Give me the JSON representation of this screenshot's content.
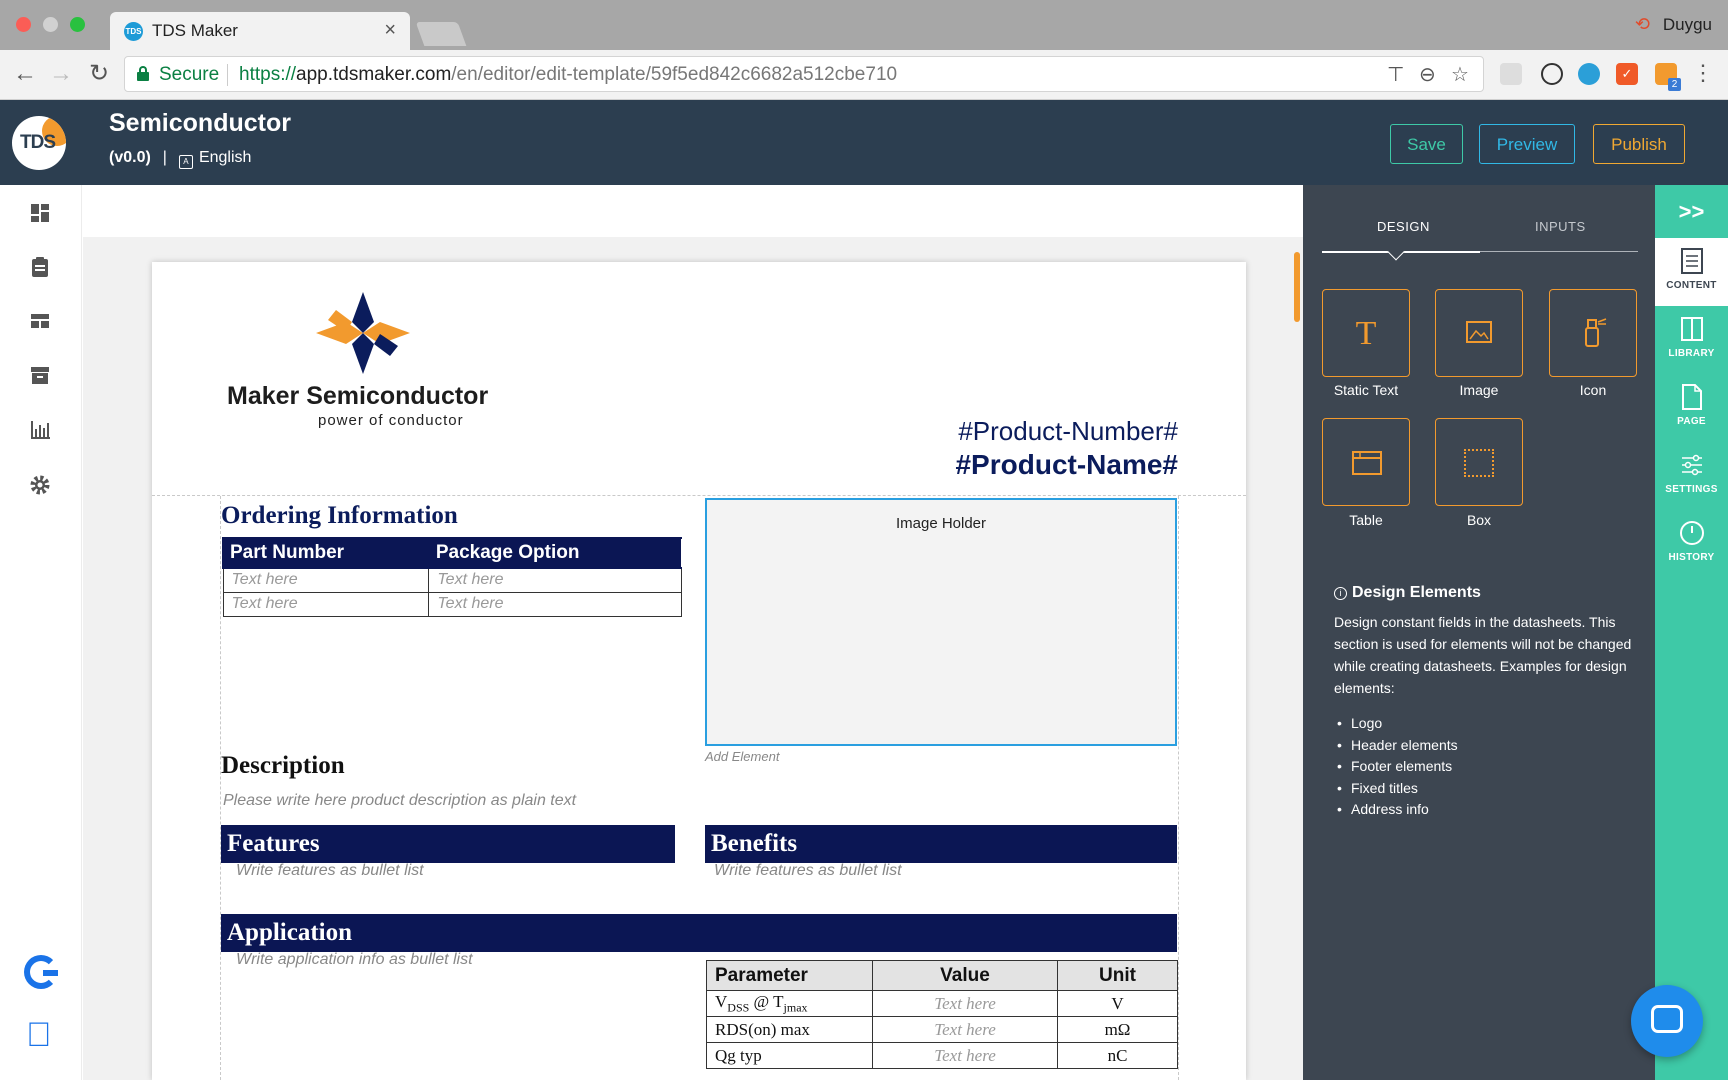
{
  "browser": {
    "tab_title": "TDS Maker",
    "tab_favicon": "TDS",
    "user": "Duygu",
    "secure_label": "Secure",
    "url_protocol": "https://",
    "url_host": "app.tdsmaker.com",
    "url_path": "/en/editor/edit-template/59f5ed842c6682a512cbe710",
    "extension_badge": "2"
  },
  "app": {
    "logo_text": "TDS",
    "doc_title": "Semiconductor",
    "version": "(v0.0)",
    "meta_sep": "|",
    "language": "English",
    "buttons": {
      "save": "Save",
      "preview": "Preview",
      "publish": "Publish"
    }
  },
  "leftbar": {
    "icons": [
      "dashboard-icon",
      "clipboard-icon",
      "layout-icon",
      "archive-icon",
      "bar-chart-icon",
      "gear-icon"
    ]
  },
  "document": {
    "company_name": "Maker Semiconductor",
    "company_tagline": "power of conductor",
    "product_number": "#Product-Number#",
    "product_name": "#Product-Name#",
    "ordering": {
      "title": "Ordering Information",
      "headers": [
        "Part Number",
        "Package Option"
      ],
      "rows": [
        [
          "Text here",
          "Text here"
        ],
        [
          "Text here",
          "Text here"
        ]
      ]
    },
    "image_holder": "Image Holder",
    "add_element": "Add Element",
    "description": {
      "title": "Description",
      "placeholder": "Please write here product description as plain text"
    },
    "features": {
      "title": "Features",
      "placeholder": "Write features as bullet list"
    },
    "benefits": {
      "title": "Benefits",
      "placeholder": "Write features as bullet list"
    },
    "application": {
      "title": "Application",
      "placeholder": "Write application info as bullet list"
    },
    "params": {
      "headers": [
        "Parameter",
        "Value",
        "Unit"
      ],
      "rows": [
        {
          "param": "V",
          "sub1": "DSS",
          "mid": " @ T",
          "sub2": "jmax",
          "value": "Text here",
          "unit": "V"
        },
        {
          "param": "RDS(on) max",
          "value": "Text here",
          "unit": "mΩ"
        },
        {
          "param": "Qg typ",
          "value": "Text here",
          "unit": "nC"
        }
      ]
    }
  },
  "panel": {
    "tabs": {
      "design": "DESIGN",
      "inputs": "INPUTS"
    },
    "elements": [
      "Static Text",
      "Image",
      "Icon",
      "Table",
      "Box"
    ],
    "info_title": "Design Elements",
    "info_text": "Design constant fields in the datasheets. This section is used for elements will not be changed while creating datasheets. Examples for design elements:",
    "examples": [
      "Logo",
      "Header elements",
      "Footer elements",
      "Fixed titles",
      "Address info"
    ]
  },
  "rail": {
    "expand": ">>",
    "items": [
      "CONTENT",
      "LIBRARY",
      "PAGE",
      "SETTINGS",
      "HISTORY"
    ]
  },
  "colors": {
    "app_header": "#2c3e50",
    "accent_green": "#3ec9a7",
    "accent_blue": "#31b8e6",
    "accent_orange": "#f0a832",
    "doc_navy": "#0b1654",
    "panel_bg": "#3d4651"
  }
}
